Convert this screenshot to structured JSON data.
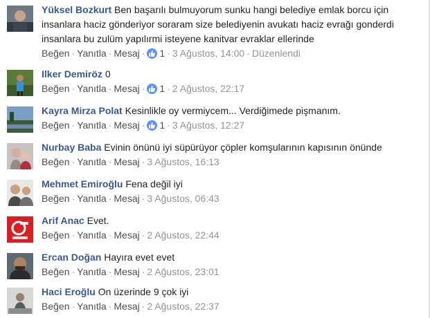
{
  "actions": {
    "like": "Beğen",
    "reply": "Yanıtla",
    "message": "Mesaj",
    "separator": "·"
  },
  "comments": [
    {
      "author": "Yüksel Bozkurt",
      "text": "Ben başarılı bulmuyorum sunku hangi belediye emlak borcu için insanlara haciz gönderiyor soraram size belediyenin avukatı haciz evrağı gonderdi insanlara bu zulüm yapılırmi isteyene kanitvar evraklar ellerinde",
      "likes": "1",
      "time": "3 Ağustos, 14:00",
      "edited": "Düzenlendi"
    },
    {
      "author": "Ilker Demiröz",
      "text": "0",
      "likes": "1",
      "time": "2 Ağustos, 22:17"
    },
    {
      "author": "Kayra Mirza Polat",
      "text": "Kesinlikle oy vermiycem... Verdiğimede pişmanım.",
      "likes": "1",
      "time": "3 Ağustos, 12:27"
    },
    {
      "author": "Nurbay Baba",
      "text": "Evinin önünü iyi süpürüyor çöpler komşularının kapısının önünde",
      "time": "3 Ağustos, 16:13"
    },
    {
      "author": "Mehmet Emiroğlu",
      "text": "Fena değil iyi",
      "time": "3 Ağustos, 06:43"
    },
    {
      "author": "Arif Anac",
      "text": "Evet.",
      "time": "2 Ağustos, 22:44"
    },
    {
      "author": "Ercan Doğan",
      "text": "Hayıra evet evet",
      "time": "2 Ağustos, 23:01"
    },
    {
      "author": "Haci Eroğlu",
      "text": "On üzerinde 9 çok iyi",
      "time": "2 Ağustos, 22:37"
    }
  ],
  "colors": {
    "author": "#385898",
    "link": "#4b4f56",
    "meta": "#90949c",
    "like_badge": "#5890ff"
  },
  "icons": {
    "like": "thumbs-up-icon"
  }
}
